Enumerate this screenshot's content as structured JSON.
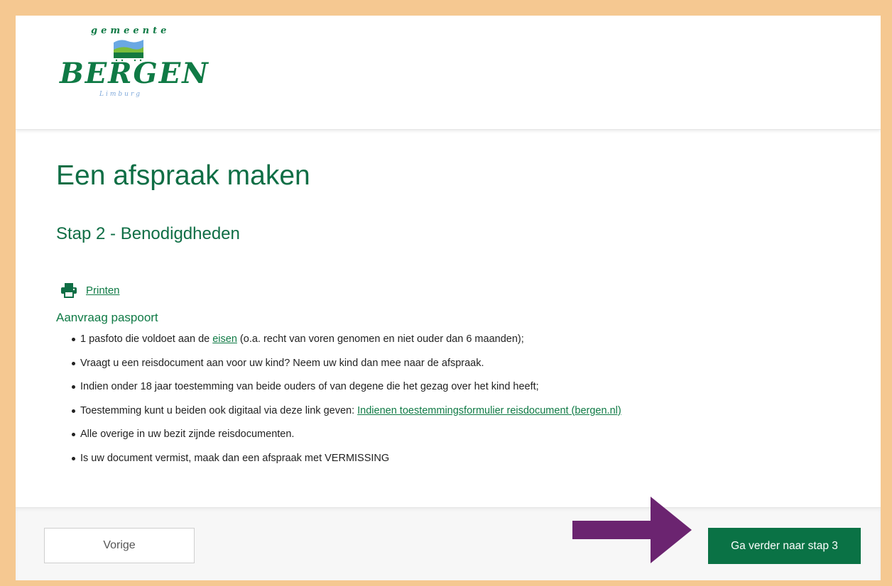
{
  "brand": {
    "logo_top": "gemeente",
    "logo_main": "BERGEN",
    "logo_sub": "Limburg"
  },
  "main": {
    "title": "Een afspraak maken",
    "step_title": "Stap 2 - Benodigdheden",
    "print_label": "Printen",
    "section_title": "Aanvraag paspoort",
    "requirements": {
      "r1_pre": "1 pasfoto die voldoet aan de ",
      "r1_link": "eisen",
      "r1_post": " (o.a. recht van voren genomen en niet ouder dan 6 maanden);",
      "r2": "Vraagt u een reisdocument aan voor uw kind? Neem uw kind dan mee naar de afspraak.",
      "r3": "Indien onder 18 jaar toestemming van beide ouders of van degene die het gezag over het kind heeft;",
      "r4_pre": "Toestemming kunt u beiden ook digitaal via deze link geven: ",
      "r4_link": "Indienen toestemmingsformulier reisdocument (bergen.nl)",
      "r5": "Alle overige in uw bezit zijnde reisdocumenten.",
      "r6": "Is uw document vermist, maak dan een afspraak met VERMISSING"
    }
  },
  "footer": {
    "prev_label": "Vorige",
    "next_label": "Ga verder naar stap 3"
  },
  "colors": {
    "brand_green": "#0a7245",
    "frame_border": "#f5c891",
    "arrow": "#6b2470"
  },
  "icons": {
    "print": "printer-icon",
    "annotation": "arrow-right-icon"
  }
}
